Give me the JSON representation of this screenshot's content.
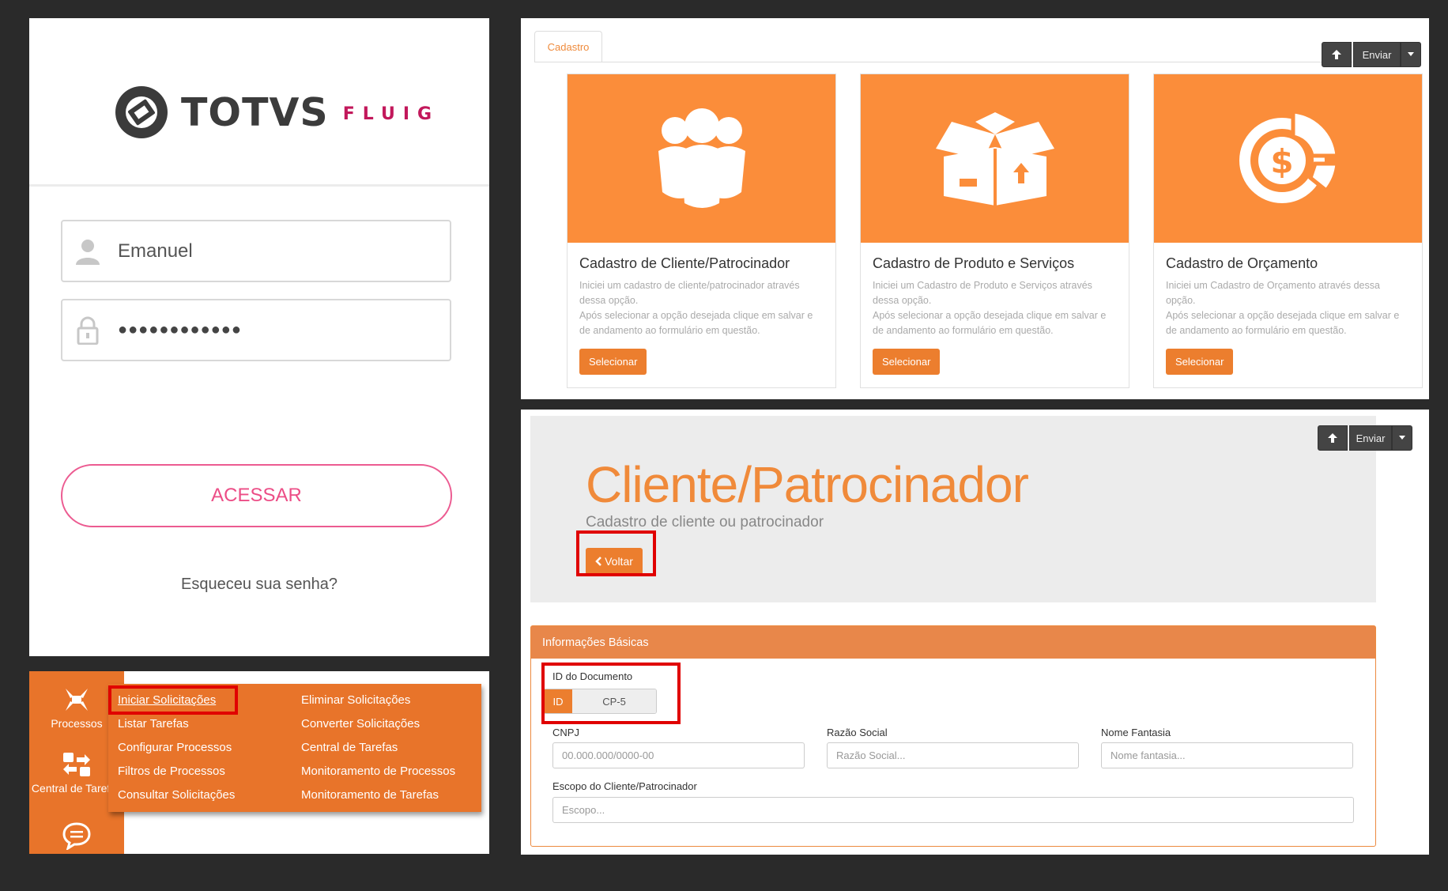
{
  "login": {
    "brand": "TOTVS",
    "brand_sub": "FLUIG",
    "username": "Emanuel",
    "password_mask": "●●●●●●●●●●●●",
    "submit_label": "ACESSAR",
    "forgot_label": "Esqueceu sua senha?",
    "colors": {
      "accent": "#ec4d86",
      "brand": "#3b3b3b"
    }
  },
  "menu": {
    "sidebar": [
      {
        "label": "Processos",
        "icon": "processes-icon"
      },
      {
        "label": "Central de Tarefas",
        "icon": "task-center-icon"
      },
      {
        "label": "",
        "icon": "chat-icon"
      }
    ],
    "col1": [
      "Iniciar Solicitações",
      "Listar Tarefas",
      "Configurar Processos",
      "Filtros de Processos",
      "Consultar Solicitações"
    ],
    "col2": [
      "Eliminar Solicitações",
      "Converter Solicitações",
      "Central de Tarefas",
      "Monitoramento de Processos",
      "Monitoramento de Tarefas"
    ],
    "active": "Iniciar Solicitações",
    "colors": {
      "menu_bg": "#e8742a",
      "highlight": "#e00000"
    }
  },
  "cadastro": {
    "tab": "Cadastro",
    "send_label": "Enviar",
    "cards": [
      {
        "title": "Cadastro de Cliente/Patrocinador",
        "desc1": "Iniciei um cadastro de cliente/patrocinador através dessa opção.",
        "desc2": "Após selecionar a opção desejada clique em salvar e de andamento ao formulário em questão.",
        "button": "Selecionar",
        "icon": "people-icon"
      },
      {
        "title": "Cadastro de Produto e Serviços",
        "desc1": "Iniciei um Cadastro de Produto e Serviços através dessa opção.",
        "desc2": "Após selecionar a opção desejada clique em salvar e de andamento ao formulário em questão.",
        "button": "Selecionar",
        "icon": "box-icon"
      },
      {
        "title": "Cadastro de Orçamento",
        "desc1": "Iniciei um Cadastro de Orçamento através dessa opção.",
        "desc2": "Após selecionar a opção desejada clique em salvar e de andamento ao formulário em questão.",
        "button": "Selecionar",
        "icon": "budget-icon"
      }
    ],
    "colors": {
      "card_header": "#fb8d3a"
    }
  },
  "form": {
    "send_label": "Enviar",
    "title": "Cliente/Patrocinador",
    "subtitle": "Cadastro de cliente ou patrocinador",
    "back_label": "Voltar",
    "section": "Informações Básicas",
    "doc_id_label": "ID do Documento",
    "doc_id_prefix": "ID",
    "doc_id_value": "CP-5",
    "cnpj_label": "CNPJ",
    "cnpj_placeholder": "00.000.000/0000-00",
    "razao_label": "Razão Social",
    "razao_placeholder": "Razão Social...",
    "fantasia_label": "Nome Fantasia",
    "fantasia_placeholder": "Nome fantasia...",
    "escopo_label": "Escopo do Cliente/Patrocinador",
    "escopo_placeholder": "Escopo..."
  }
}
